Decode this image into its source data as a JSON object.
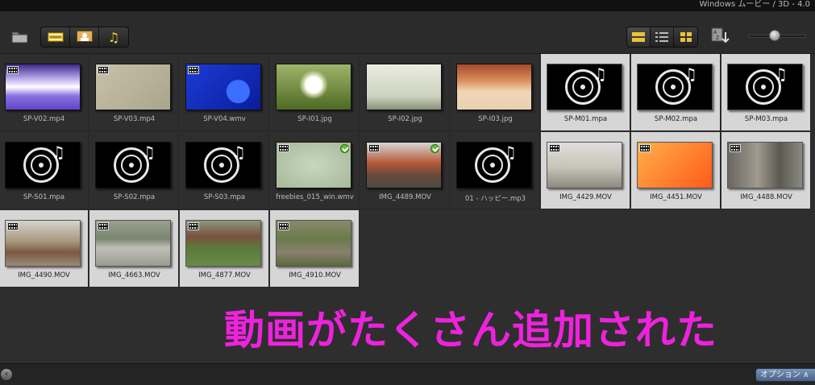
{
  "window": {
    "title": "Windows ムービー / 3D - 4.0"
  },
  "toolbar": {
    "folder_icon": "folder-icon",
    "filter_buttons": [
      {
        "name": "video-filter",
        "icon": "film-strip-icon"
      },
      {
        "name": "photo-filter",
        "icon": "photo-icon"
      },
      {
        "name": "music-filter",
        "icon": "music-note-icon"
      }
    ],
    "view_buttons": [
      {
        "name": "view-large",
        "icon": "large-view-icon",
        "active": true
      },
      {
        "name": "view-list",
        "icon": "list-view-icon",
        "active": false
      },
      {
        "name": "view-thumbnail",
        "icon": "thumbnail-view-icon",
        "active": false
      }
    ],
    "sort_icon": "sort-az-icon",
    "zoom_level": 0.45
  },
  "media": [
    {
      "name": "SP-V02.mp4",
      "type": "video",
      "selected": false,
      "checked": false
    },
    {
      "name": "SP-V03.mp4",
      "type": "video",
      "selected": false,
      "checked": false
    },
    {
      "name": "SP-V04.wmv",
      "type": "video",
      "selected": false,
      "checked": false
    },
    {
      "name": "SP-I01.jpg",
      "type": "image",
      "selected": false,
      "checked": false
    },
    {
      "name": "SP-I02.jpg",
      "type": "image",
      "selected": false,
      "checked": false
    },
    {
      "name": "SP-I03.jpg",
      "type": "image",
      "selected": false,
      "checked": false
    },
    {
      "name": "SP-M01.mpa",
      "type": "audio",
      "selected": true,
      "checked": false
    },
    {
      "name": "SP-M02.mpa",
      "type": "audio",
      "selected": true,
      "checked": false
    },
    {
      "name": "SP-M03.mpa",
      "type": "audio",
      "selected": true,
      "checked": false
    },
    {
      "name": "SP-S01.mpa",
      "type": "audio",
      "selected": false,
      "checked": false
    },
    {
      "name": "SP-S02.mpa",
      "type": "audio",
      "selected": false,
      "checked": false
    },
    {
      "name": "SP-S03.mpa",
      "type": "audio",
      "selected": false,
      "checked": false
    },
    {
      "name": "freebies_015_win.wmv",
      "type": "video",
      "selected": false,
      "checked": true
    },
    {
      "name": "IMG_4489.MOV",
      "type": "video",
      "selected": false,
      "checked": true
    },
    {
      "name": "01 - ハッピー.mp3",
      "type": "audio",
      "selected": false,
      "checked": false
    },
    {
      "name": "IMG_4429.MOV",
      "type": "video",
      "selected": true,
      "checked": false
    },
    {
      "name": "IMG_4451.MOV",
      "type": "video",
      "selected": true,
      "checked": false
    },
    {
      "name": "IMG_4488.MOV",
      "type": "video",
      "selected": true,
      "checked": false
    },
    {
      "name": "IMG_4490.MOV",
      "type": "video",
      "selected": true,
      "checked": false
    },
    {
      "name": "IMG_4663.MOV",
      "type": "video",
      "selected": true,
      "checked": false
    },
    {
      "name": "IMG_4877.MOV",
      "type": "video",
      "selected": true,
      "checked": false
    },
    {
      "name": "IMG_4910.MOV",
      "type": "video",
      "selected": true,
      "checked": false
    }
  ],
  "overlay_text": "動画がたくさん追加された",
  "bottom": {
    "options_label": "オプション ∧"
  },
  "colors": {
    "overlay": "#ee22dd",
    "selected_bg": "#d6d6d6",
    "panel_bg": "#2e2e2e"
  }
}
